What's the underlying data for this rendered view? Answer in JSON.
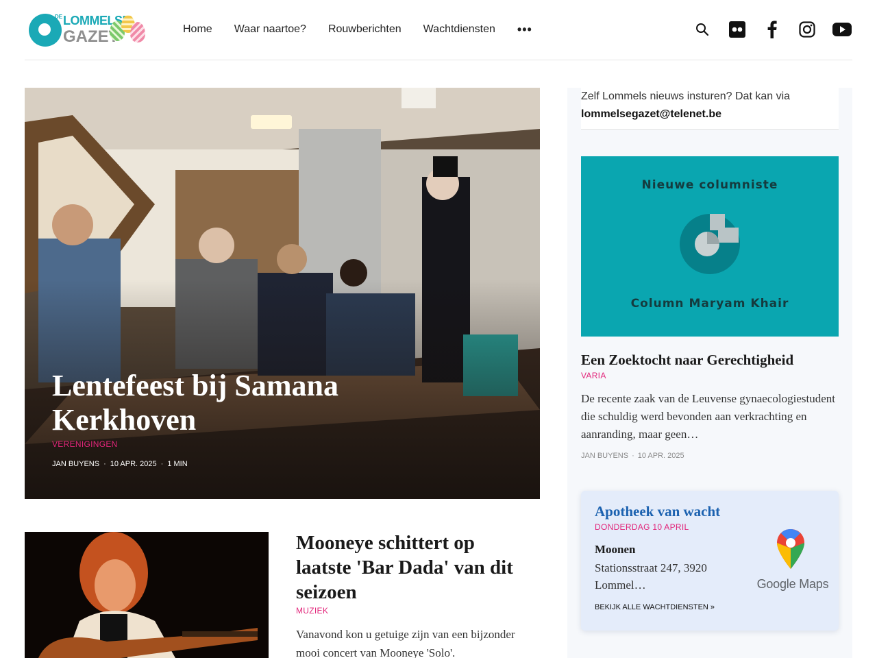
{
  "header": {
    "logo": {
      "prefix": "DE",
      "line1": "LOMMELSE",
      "line2": "GAZET"
    },
    "nav": [
      "Home",
      "Waar naartoe?",
      "Rouwberichten",
      "Wachtdiensten"
    ],
    "more_label": "•••",
    "icons": [
      "search-icon",
      "flickr-icon",
      "facebook-icon",
      "instagram-icon",
      "youtube-icon"
    ]
  },
  "featured": {
    "title": "Lentefeest bij Samana Kerkhoven",
    "category": "VERENIGINGEN",
    "author": "JAN BUYENS",
    "date": "10 APR. 2025",
    "read_time": "1 MIN"
  },
  "article2": {
    "title": "Mooneye schittert op laatste 'Bar Dada' van dit seizoen",
    "category": "MUZIEK",
    "excerpt": "Vanavond kon u getuige zijn van een bijzonder mooi concert van Mooneye 'Solo'."
  },
  "sidebar": {
    "intro_text": "Zelf Lommels nieuws insturen? Dat kan via",
    "intro_email": "lommelsegazet@telenet.be",
    "column_image": {
      "heading": "Nieuwe columniste",
      "footer": "Column Maryam Khair"
    },
    "article": {
      "title": "Een Zoektocht naar Gerechtigheid",
      "category": "VARIA",
      "excerpt": "De recente zaak van de Leuvense gynaecologiestudent die schuldig werd bevonden aan verkrachting en aanranding, maar geen…",
      "author": "JAN BUYENS",
      "date": "10 APR. 2025"
    },
    "pharmacy": {
      "title": "Apotheek van wacht",
      "date": "DONDERDAG 10 APRIL",
      "name": "Moonen",
      "address": "Stationsstraat 247, 3920 Lommel…",
      "link": "BEKIJK ALLE WACHTDIENSTEN »",
      "maps_label": "Google Maps"
    }
  },
  "colors": {
    "accent_pink": "#e2257a",
    "teal": "#0aa6b0",
    "pharmacy_blue": "#1c62b0"
  }
}
